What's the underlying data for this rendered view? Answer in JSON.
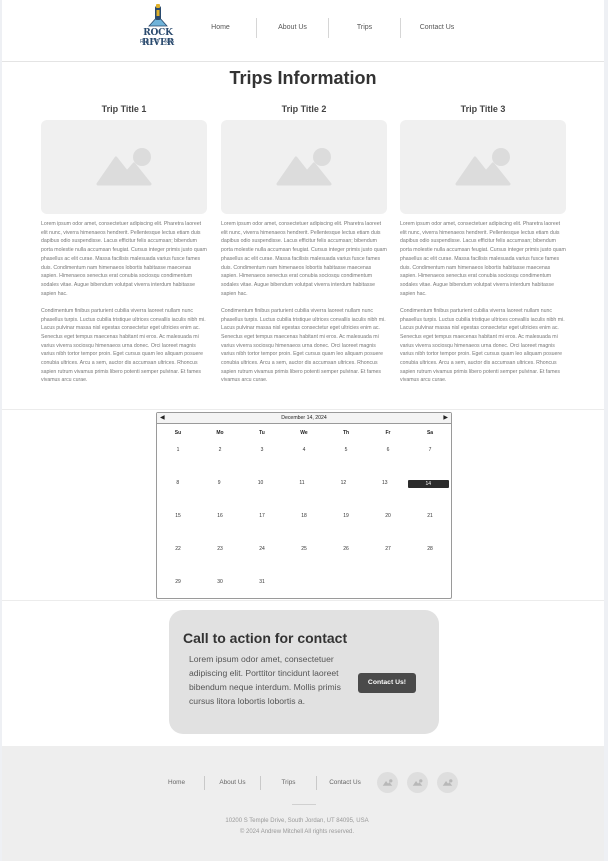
{
  "header": {
    "logo": {
      "brand": "ROCK RIVER",
      "sub": "RAFTING",
      "icon": "raft-logo-icon"
    },
    "nav": [
      "Home",
      "About Us",
      "Trips",
      "Contact Us"
    ]
  },
  "main": {
    "title": "Trips Information",
    "trips": [
      {
        "title": "Trip Title 1",
        "image_icon": "image-placeholder-icon",
        "p1": "Lorem ipsum odor amet, consectetuer adipiscing elit. Pharetra laoreet elit nunc, viverra himenaeos hendrerit. Pellentesque lectus etiam duis dapibus odio suspendisse. Lacus efficitur felis accumsan; bibendum porta molestie nulla accumsan feugiat. Cursus integer primis justo quam phasellus ac elit curae. Massa facilisis malesuada varius fusce fames duis. Condimentum nam himenaeos lobortis habitasse maecenas sapien. Himenaeos senectus erat conubia sociosqu condimentum sodales vitae. Augue bibendum volutpat viverra interdum habitasse sapien hac.",
        "p2": "Condimentum finibus parturient cubilia viverra laoreet nullam nunc phasellus turpis. Luctus cubilia tristique ultrices convallis iaculis nibh mi. Lacus pulvinar massa nisl egestas consectetur eget ultricies enim ac. Senectus eget tempus maecenas habitant mi eros. Ac malesuada mi varius viverra sociosqu himenaeos urna donec. Orci laoreet magnis varius nibh tortor tempor proin. Eget cursus quam leo aliquam posuere conubia ultrices. Arcu a sem, auctor dis accumsan ultrices. Rhoncus sapien rutrum vivamus primis libero potenti semper pulvinar. Et fames vivamus arcu curae."
      },
      {
        "title": "Trip Title 2",
        "image_icon": "image-placeholder-icon",
        "p1": "Lorem ipsum odor amet, consectetuer adipiscing elit. Pharetra laoreet elit nunc, viverra himenaeos hendrerit. Pellentesque lectus etiam duis dapibus odio suspendisse. Lacus efficitur felis accumsan; bibendum porta molestie nulla accumsan feugiat. Cursus integer primis justo quam phasellus ac elit curae. Massa facilisis malesuada varius fusce fames duis. Condimentum nam himenaeos lobortis habitasse maecenas sapien. Himenaeos senectus erat conubia sociosqu condimentum sodales vitae. Augue bibendum volutpat viverra interdum habitasse sapien hac.",
        "p2": "Condimentum finibus parturient cubilia viverra laoreet nullam nunc phasellus turpis. Luctus cubilia tristique ultrices convallis iaculis nibh mi. Lacus pulvinar massa nisl egestas consectetur eget ultricies enim ac. Senectus eget tempus maecenas habitant mi eros. Ac malesuada mi varius viverra sociosqu himenaeos urna donec. Orci laoreet magnis varius nibh tortor tempor proin. Eget cursus quam leo aliquam posuere conubia ultrices. Arcu a sem, auctor dis accumsan ultrices. Rhoncus sapien rutrum vivamus primis libero potenti semper pulvinar. Et fames vivamus arcu curae."
      },
      {
        "title": "Trip Title 3",
        "image_icon": "image-placeholder-icon",
        "p1": "Lorem ipsum odor amet, consectetuer adipiscing elit. Pharetra laoreet elit nunc, viverra himenaeos hendrerit. Pellentesque lectus etiam duis dapibus odio suspendisse. Lacus efficitur felis accumsan; bibendum porta molestie nulla accumsan feugiat. Cursus integer primis justo quam phasellus ac elit curae. Massa facilisis malesuada varius fusce fames duis. Condimentum nam himenaeos lobortis habitasse maecenas sapien. Himenaeos senectus erat conubia sociosqu condimentum sodales vitae. Augue bibendum volutpat viverra interdum habitasse sapien hac.",
        "p2": "Condimentum finibus parturient cubilia viverra laoreet nullam nunc phasellus turpis. Luctus cubilia tristique ultrices convallis iaculis nibh mi. Lacus pulvinar massa nisl egestas consectetur eget ultricies enim ac. Senectus eget tempus maecenas habitant mi eros. Ac malesuada mi varius viverra sociosqu himenaeos urna donec. Orci laoreet magnis varius nibh tortor tempor proin. Eget cursus quam leo aliquam posuere conubia ultrices. Arcu a sem, auctor dis accumsan ultrices. Rhoncus sapien rutrum vivamus primis libero potenti semper pulvinar. Et fames vivamus arcu curae."
      }
    ]
  },
  "calendar": {
    "month_label": "December 14, 2024",
    "prev_icon": "◀",
    "next_icon": "▶",
    "days_of_week": [
      "Su",
      "Mo",
      "Tu",
      "We",
      "Th",
      "Fr",
      "Sa"
    ],
    "weeks": [
      [
        "1",
        "2",
        "3",
        "4",
        "5",
        "6",
        "7"
      ],
      [
        "8",
        "9",
        "10",
        "11",
        "12",
        "13",
        "14"
      ],
      [
        "15",
        "16",
        "17",
        "18",
        "19",
        "20",
        "21"
      ],
      [
        "22",
        "23",
        "24",
        "25",
        "26",
        "27",
        "28"
      ],
      [
        "29",
        "30",
        "31",
        "",
        "",
        "",
        ""
      ]
    ],
    "selected": "14"
  },
  "cta": {
    "title": "Call to action for contact",
    "text": "Lorem ipsum odor amet, consectetuer adipiscing elit. Porttitor tincidunt laoreet bibendum neque interdum. Mollis primis cursus litora lobortis lobortis a.",
    "button": "Contact Us!"
  },
  "footer": {
    "nav": [
      "Home",
      "About Us",
      "Trips",
      "Contact Us"
    ],
    "social_icons": [
      "social-icon-1",
      "social-icon-2",
      "social-icon-3"
    ],
    "address": "10200 S Temple Drive, South Jordan, UT 84095, USA",
    "copyright": "© 2024 Andrew Mitchell  All rights reserved."
  },
  "colors": {
    "primary_text": "#333333",
    "button_bg": "#4a4a4a",
    "selected_day_bg": "#2b2b2b",
    "cta_bg": "#e1e1e1",
    "footer_bg": "#eeeeee"
  }
}
